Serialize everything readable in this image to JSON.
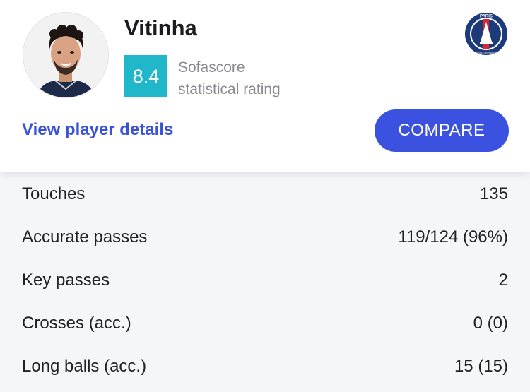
{
  "player": {
    "name": "Vitinha",
    "rating": "8.4",
    "rating_label_line1": "Sofascore",
    "rating_label_line2": "statistical rating",
    "club_badge_text": "PARIS",
    "club_badge_subtext": "SAINT-GERMAIN"
  },
  "actions": {
    "details_link": "View player details",
    "compare_button": "COMPARE"
  },
  "colors": {
    "rating_bg": "#1fb7c9",
    "accent_blue": "#3b52e0",
    "club_navy": "#1d3a7a",
    "club_red": "#d8292f"
  },
  "stats": [
    {
      "label": "Touches",
      "value": "135"
    },
    {
      "label": "Accurate passes",
      "value": "119/124 (96%)"
    },
    {
      "label": "Key passes",
      "value": "2"
    },
    {
      "label": "Crosses (acc.)",
      "value": "0 (0)"
    },
    {
      "label": "Long balls (acc.)",
      "value": "15 (15)"
    }
  ]
}
